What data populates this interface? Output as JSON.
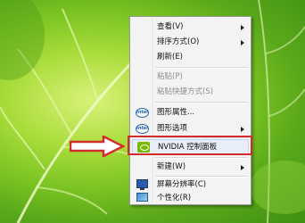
{
  "menu": {
    "items": [
      {
        "label": "查看(V)",
        "has_submenu": true,
        "enabled": true
      },
      {
        "label": "排序方式(O)",
        "has_submenu": true,
        "enabled": true
      },
      {
        "label": "刷新(E)",
        "has_submenu": false,
        "enabled": true
      },
      {
        "label": "粘贴(P)",
        "has_submenu": false,
        "enabled": false
      },
      {
        "label": "粘贴快捷方式(S)",
        "has_submenu": false,
        "enabled": false
      },
      {
        "label": "图形属性...",
        "has_submenu": false,
        "enabled": true,
        "icon": "intel-graphics-icon"
      },
      {
        "label": "图形选项",
        "has_submenu": true,
        "enabled": true,
        "icon": "intel-graphics-icon"
      },
      {
        "label": "NVIDIA 控制面板",
        "has_submenu": false,
        "enabled": true,
        "icon": "nvidia-icon",
        "highlighted": true
      },
      {
        "label": "新建(W)",
        "has_submenu": true,
        "enabled": true
      },
      {
        "label": "屏幕分辨率(C)",
        "has_submenu": false,
        "enabled": true,
        "icon": "monitor-icon"
      },
      {
        "label": "个性化(R)",
        "has_submenu": false,
        "enabled": true,
        "icon": "personalize-icon"
      }
    ],
    "intel_icon_text": "intel"
  },
  "annotation": {
    "highlight_color": "#d42c2c",
    "arrow_color": "#d42c2c"
  }
}
